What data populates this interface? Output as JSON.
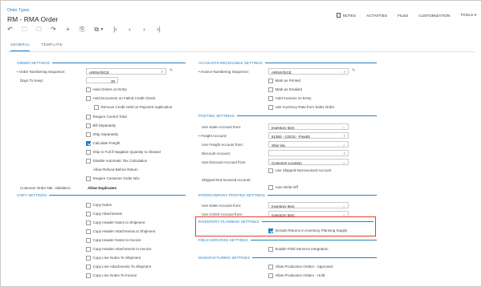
{
  "header": {
    "breadcrumb": "Order Types",
    "title": "RM - RMA Order",
    "nav": [
      "NOTES",
      "ACTIVITIES",
      "FILES",
      "CUSTOMIZATION",
      "TOOLS ▾"
    ]
  },
  "toolbar": {
    "icons": [
      "↶",
      "☐",
      "☐",
      "↷",
      "+",
      "⎘",
      "⧉ ▾",
      "|‹",
      "‹",
      "›",
      "›|"
    ]
  },
  "tabs": [
    "GENERAL",
    "TEMPLATE"
  ],
  "left": {
    "order_settings": "ORDER SETTINGS",
    "order_numbering_label": "• Order Numbering Sequence:",
    "order_numbering_value": "ARINVOICE",
    "days_to_keep_label": "Days To Keep:",
    "days_to_keep_value": "30",
    "checks": [
      {
        "label": "Hold Orders on Entry",
        "on": false
      },
      {
        "label": "Hold Document on Failed Credit Check",
        "on": false
      },
      {
        "label": "Remove Credit Hold on Payment Application",
        "on": false
      },
      {
        "label": "Require Control Total",
        "on": false
      },
      {
        "label": "Bill Separately",
        "on": false
      },
      {
        "label": "Ship Separately",
        "on": false
      },
      {
        "label": "Calculate Freight",
        "on": true
      },
      {
        "label": "Ship in Full if Negative Quantity Is Allowed",
        "on": false
      },
      {
        "label": "Disable Automatic Tax Calculation",
        "on": false
      }
    ],
    "allow_refund": "Allow Refund Before Return",
    "require_customer_order": "Require Customer Order Nbr.",
    "customer_validation_label": "Customer Order Nbr. Validation:",
    "customer_validation_value": "Allow Duplicates",
    "copy_settings": "COPY SETTINGS",
    "copy_checks": [
      "Copy Notes",
      "Copy Attachments",
      "Copy Header Notes to Shipment",
      "Copy Header Attachments to Shipment",
      "Copy Header Notes to Invoice",
      "Copy Header Attachments to Invoice",
      "Copy Line Notes To Shipment",
      "Copy Line Attachments To Shipment",
      "Copy Line Notes To Invoice"
    ]
  },
  "right": {
    "ar_settings": "ACCOUNTS RECEIVABLE SETTINGS",
    "invoice_numbering_label": "• Invoice Numbering Sequence:",
    "invoice_numbering_value": "ARINVOICE",
    "ar_checks": [
      "Mark as Printed",
      "Mark as Emailed",
      "Hold Invoices on Entry",
      "Use Currency Rate from Sales Order"
    ],
    "posting_settings": "POSTING SETTINGS",
    "posting_rows": [
      {
        "label": "Use Sales Account from:",
        "value": "Inventory Item",
        "icon": "⌄"
      },
      {
        "label": "• Freight Account:",
        "value": "51300 - COGS - Freight",
        "icon": "⌕"
      },
      {
        "label": "Use Freight Account from:",
        "value": "Ship Via",
        "icon": "⌄"
      },
      {
        "label": "Discount Account:",
        "value": "",
        "icon": "⌕"
      },
      {
        "label": "Use Discount Account from:",
        "value": "Customer Location",
        "icon": "⌄"
      }
    ],
    "use_shipped_not_invoiced": "Use Shipped-Not-Invoiced Account",
    "shipped_not_invoiced_label": "Shipped-Not-Invoiced Account:",
    "auto_write_off": "Auto Write-Off",
    "intercompany": "INTERCOMPANY POSTING SETTINGS",
    "ic_rows": [
      {
        "label": "Use Sales Account from:",
        "value": "Inventory Item"
      },
      {
        "label": "Use COGS Account from:",
        "value": "Inventory Item"
      }
    ],
    "inventory_planning": "INVENTORY PLANNING SETTINGS",
    "include_returns": "Include Returns in Inventory Planning Supply",
    "field_services": "FIELD SERVICES SETTINGS",
    "enable_field_services": "Enable Field Services Integration",
    "manufacturing": "MANUFACTURING SETTINGS",
    "mfg_checks": [
      "Allow Production Orders - Approved",
      "Allow Production Orders - Hold"
    ]
  }
}
